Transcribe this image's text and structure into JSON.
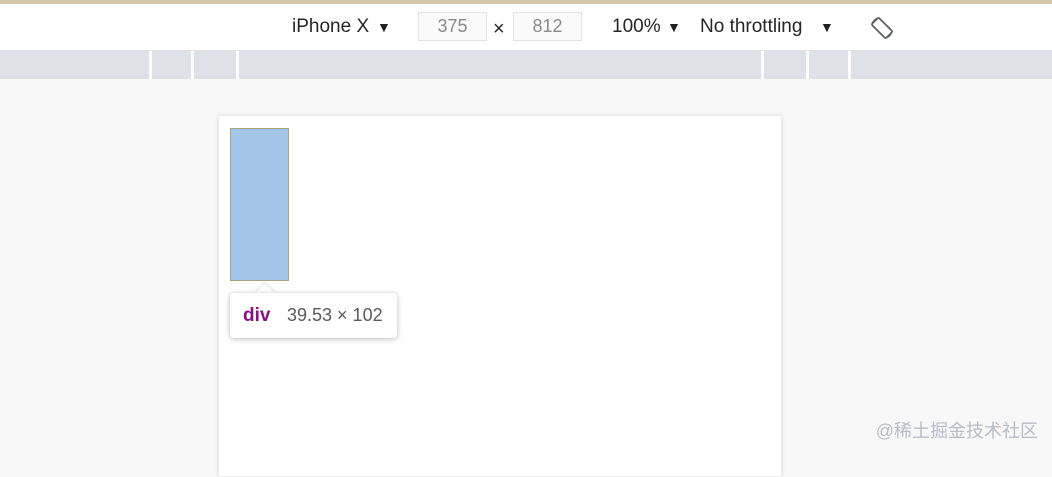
{
  "toolbar": {
    "device": "iPhone X",
    "width": "375",
    "height": "812",
    "times": "×",
    "zoom": "100%",
    "throttling": "No throttling",
    "dropdown_icon": "caret-down-icon",
    "rotate_icon": "rotate-device-icon"
  },
  "tooltip": {
    "tag": "div",
    "dimensions": "39.53 × 102"
  },
  "watermark": "@稀土掘金技术社区",
  "colors": {
    "highlight_fill": "#a2c5e9",
    "tag_color": "#881280"
  }
}
